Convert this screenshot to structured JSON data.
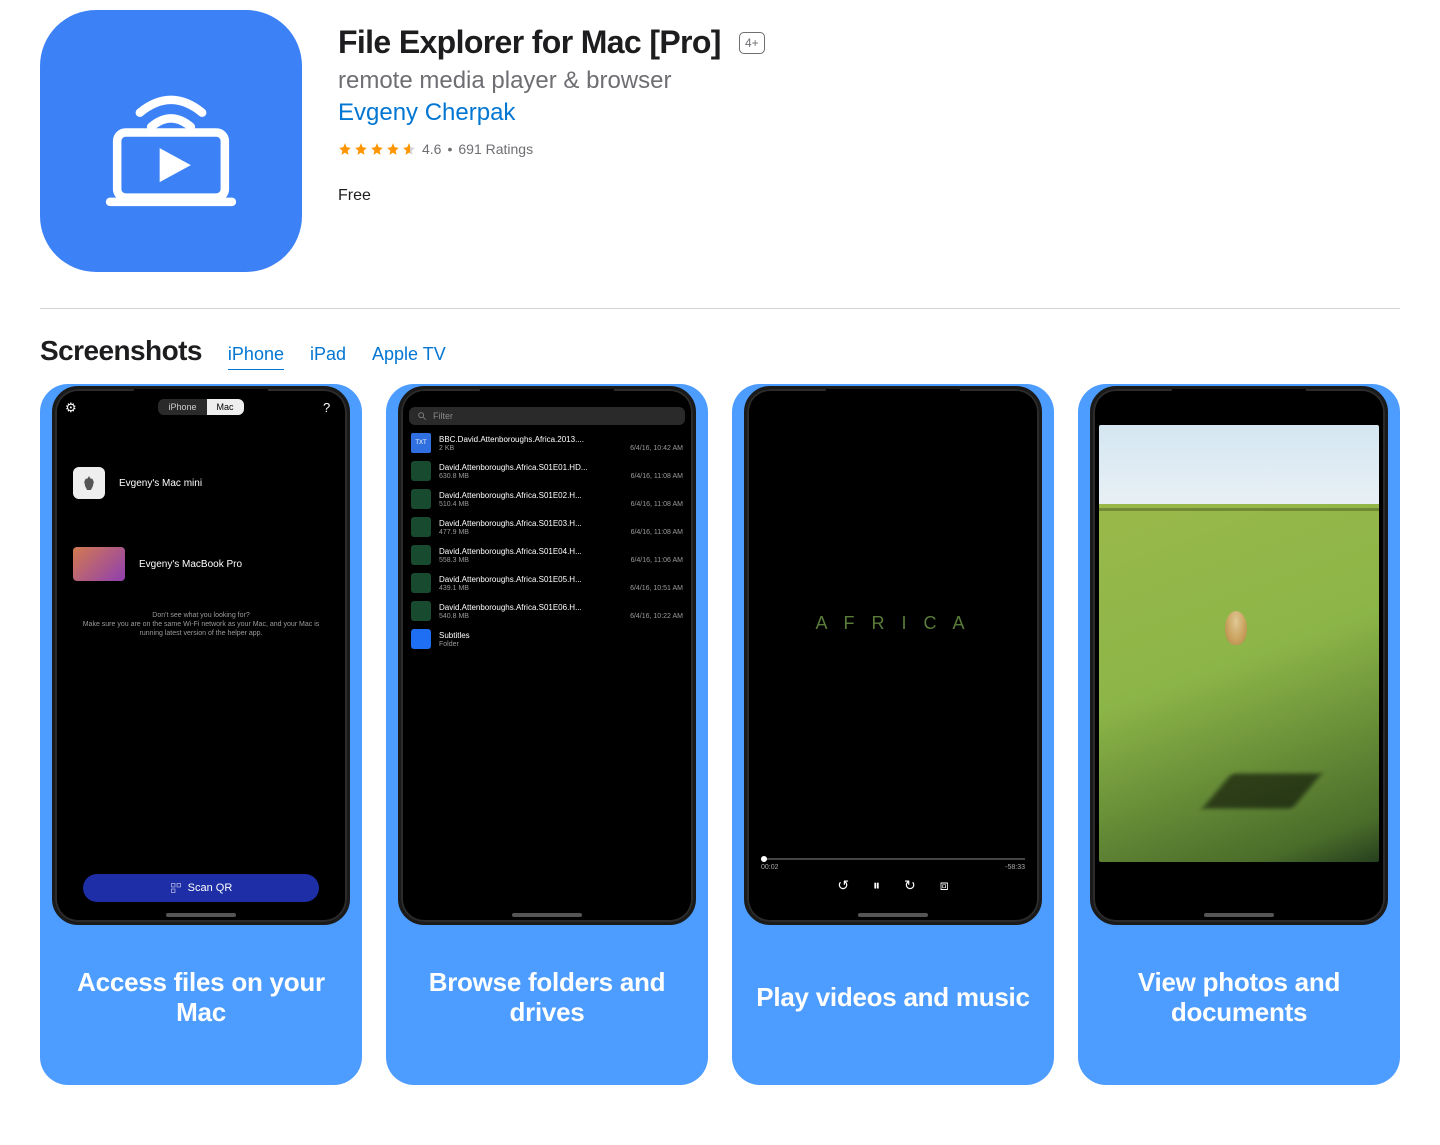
{
  "app": {
    "title": "File Explorer for Mac [Pro]",
    "age_rating": "4+",
    "subtitle": "remote media player & browser",
    "developer": "Evgeny Cherpak",
    "rating_value": "4.6",
    "rating_sep": "•",
    "ratings_count": "691 Ratings",
    "price": "Free"
  },
  "tabs": {
    "section_title": "Screenshots",
    "iphone": "iPhone",
    "ipad": "iPad",
    "appletv": "Apple TV"
  },
  "shots": {
    "s1": {
      "seg_iphone": "iPhone",
      "seg_mac": "Mac",
      "device1": "Evgeny's Mac mini",
      "device2": "Evgeny's MacBook Pro",
      "hint1": "Don't see what you looking for?",
      "hint2": "Make sure you are on the same Wi-Fi network as your Mac, and your Mac is running latest version of the helper app.",
      "qr": "Scan QR",
      "caption": "Access files on your Mac"
    },
    "s2": {
      "filter_ph": "Filter",
      "rows": [
        {
          "name": "BBC.David.Attenboroughs.Africa.2013....",
          "size": "2 KB",
          "date": "6/4/16, 10:42 AM",
          "icon": "txt"
        },
        {
          "name": "David.Attenboroughs.Africa.S01E01.HD...",
          "size": "630.8 MB",
          "date": "6/4/16, 11:08 AM",
          "icon": "vid"
        },
        {
          "name": "David.Attenboroughs.Africa.S01E02.H...",
          "size": "510.4 MB",
          "date": "6/4/16, 11:08 AM",
          "icon": "vid"
        },
        {
          "name": "David.Attenboroughs.Africa.S01E03.H...",
          "size": "477.9 MB",
          "date": "6/4/16, 11:08 AM",
          "icon": "vid"
        },
        {
          "name": "David.Attenboroughs.Africa.S01E04.H...",
          "size": "558.3 MB",
          "date": "6/4/16, 11:06 AM",
          "icon": "vid"
        },
        {
          "name": "David.Attenboroughs.Africa.S01E05.H...",
          "size": "439.1 MB",
          "date": "6/4/16, 10:51 AM",
          "icon": "vid"
        },
        {
          "name": "David.Attenboroughs.Africa.S01E06.H...",
          "size": "540.8 MB",
          "date": "6/4/16, 10:22 AM",
          "icon": "vid"
        },
        {
          "name": "Subtitles",
          "size": "Folder",
          "date": "",
          "icon": "folder"
        }
      ],
      "caption": "Browse folders and drives"
    },
    "s3": {
      "title": "A F R I C A",
      "elapsed": "00:02",
      "remaining": "-58:33",
      "caption": "Play videos and music"
    },
    "s4": {
      "caption": "View photos and documents"
    }
  }
}
